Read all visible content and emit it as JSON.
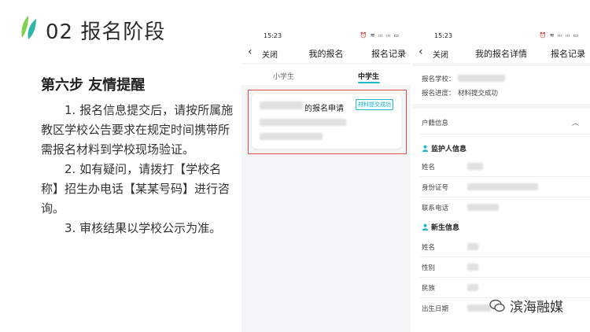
{
  "header": {
    "section_title": "02 报名阶段"
  },
  "left": {
    "step_title": "第六步 友情提醒",
    "paragraphs": [
      "1. 报名信息提交后，请按所属施教区学校公告要求在规定时间携带所需报名材料到学校现场验证。",
      "2. 如有疑问，请拨打【学校名称】招生办电话【某某号码】进行咨询。",
      "3. 审核结果以学校公示为准。"
    ]
  },
  "phone1": {
    "time": "15:23",
    "status_icons": "⏰ ≋ ᵢₗₗ ᵢₗₗ ▭",
    "nav": {
      "close": "关闭",
      "title": "我的报名",
      "right": "报名记录"
    },
    "tabs": [
      "小学生",
      "中学生"
    ],
    "card": {
      "title": "的报名申请",
      "badge": "材料提交成功"
    }
  },
  "phone2": {
    "time": "15:23",
    "status_icons": "⏰ ≋ ᵢₗₗ ᵢₗₗ ▭",
    "nav": {
      "close": "关闭",
      "title": "我的报名详情",
      "right": "报名记录"
    },
    "school_label": "报名学校：",
    "progress_label": "报名进度：",
    "progress_value": "材料提交成功",
    "huji": "户籍信息",
    "guardian": "监护人信息",
    "guardian_fields": [
      "姓名",
      "身份证号",
      "联系电话"
    ],
    "student": "新生信息",
    "student_fields": [
      "姓名",
      "性别",
      "民族",
      "出生日期"
    ]
  },
  "watermark": {
    "text": "滨海融媒"
  },
  "colors": {
    "accent": "#21b7c9",
    "highlight": "#e54d4d",
    "logo_green": "#7fd14a"
  }
}
